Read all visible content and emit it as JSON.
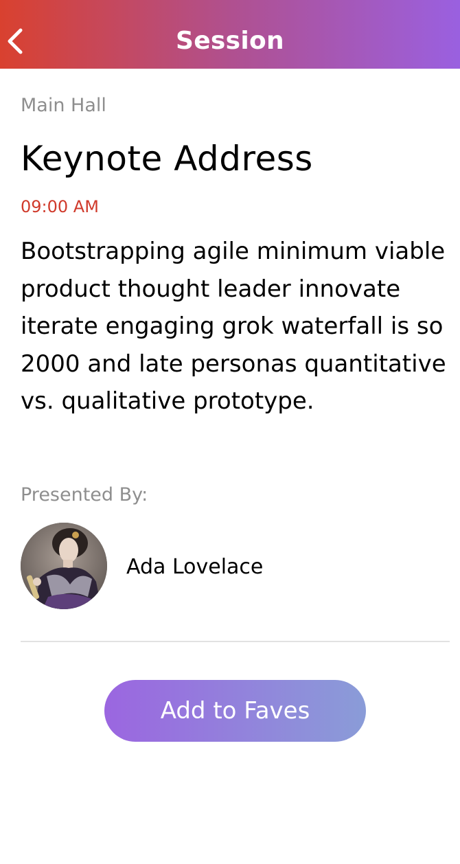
{
  "header": {
    "title": "Session",
    "back_icon": "chevron-left-icon"
  },
  "session": {
    "location": "Main Hall",
    "title": "Keynote Address",
    "time": "09:00 AM",
    "description": "Bootstrapping agile minimum viable product thought leader innovate iterate engaging grok waterfall is so 2000 and late personas quantitative vs. qualitative prototype."
  },
  "presenters": {
    "label": "Presented By:",
    "items": [
      {
        "name": "Ada Lovelace",
        "avatar_icon": "speaker-avatar"
      }
    ]
  },
  "actions": {
    "fave_label": "Add to Faves"
  },
  "colors": {
    "header_gradient_start": "#d9412f",
    "header_gradient_end": "#9a60e0",
    "time_color": "#d03a2b",
    "muted_text": "#8e8e8e",
    "button_gradient_start": "#9b66e0",
    "button_gradient_end": "#8a9cd8"
  }
}
